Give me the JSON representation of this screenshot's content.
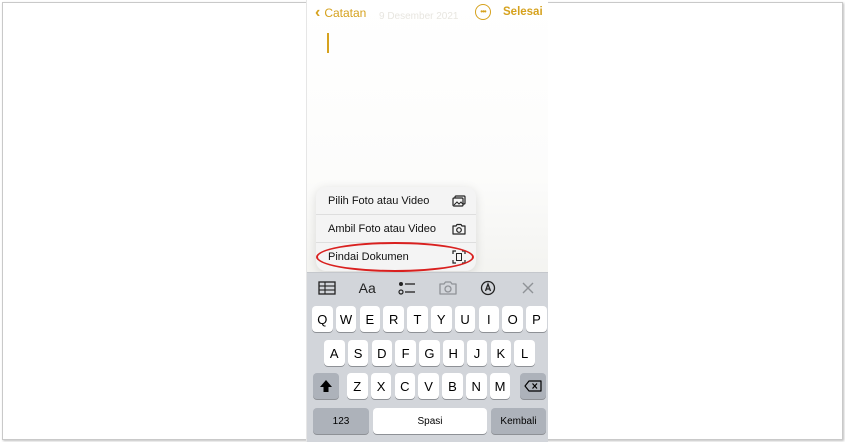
{
  "header": {
    "back_label": "Catatan",
    "date_text": "9 Desember 2021",
    "done_label": "Selesai"
  },
  "menu": {
    "items": [
      {
        "label": "Pilih Foto atau Video",
        "icon": "photo-library-icon"
      },
      {
        "label": "Ambil Foto atau Video",
        "icon": "camera-icon"
      },
      {
        "label": "Pindai Dokumen",
        "icon": "scan-document-icon"
      }
    ]
  },
  "toolbar": {
    "format_label": "Aa"
  },
  "keyboard": {
    "row1": [
      "Q",
      "W",
      "E",
      "R",
      "T",
      "Y",
      "U",
      "I",
      "O",
      "P"
    ],
    "row2": [
      "A",
      "S",
      "D",
      "F",
      "G",
      "H",
      "J",
      "K",
      "L"
    ],
    "row3": [
      "Z",
      "X",
      "C",
      "V",
      "B",
      "N",
      "M"
    ],
    "numbers_label": "123",
    "space_label": "Spasi",
    "return_label": "Kembali"
  },
  "colors": {
    "accent": "#d6a21e",
    "highlight": "#d9201f",
    "keyboard_bg": "#d2d5da"
  }
}
